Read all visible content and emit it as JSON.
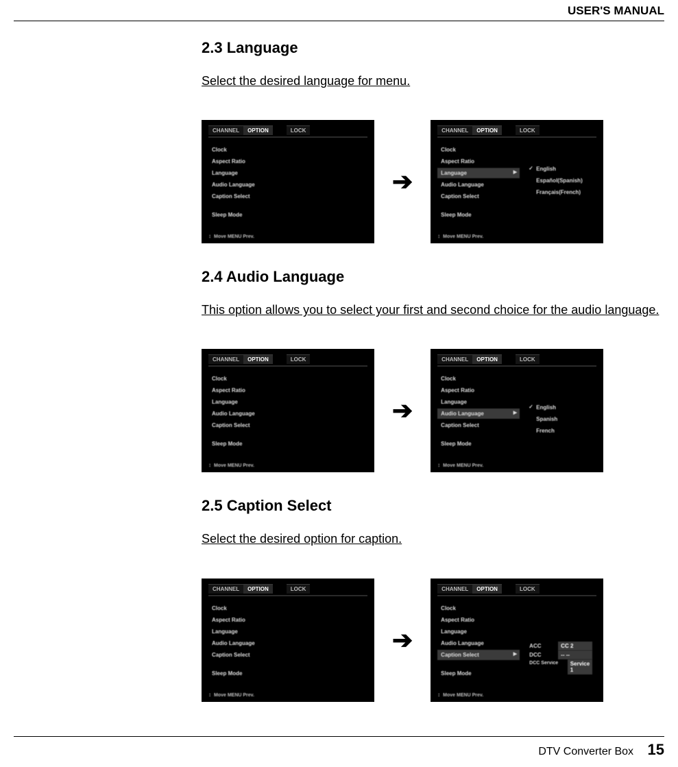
{
  "header": {
    "title": "USER'S MANUAL"
  },
  "footer": {
    "product": "DTV Converter Box",
    "page": "15"
  },
  "sections": [
    {
      "num": "2.3 Language",
      "desc": "Select the desired language for menu."
    },
    {
      "num": "2.4 Audio Language",
      "desc": "This option allows you to select your first and second choice for the audio language."
    },
    {
      "num": "2.5 Caption Select",
      "desc": "Select the desired option for caption."
    }
  ],
  "tv_common": {
    "tabs": {
      "channel": "CHANNEL",
      "option": "OPTION",
      "lock": "LOCK"
    },
    "menu_items": {
      "clock": "Clock",
      "aspect": "Aspect Ratio",
      "language": "Language",
      "audio": "Audio Language",
      "caption": "Caption Select",
      "sleep": "Sleep Mode"
    },
    "footer_hint": "Move  MENU Prev."
  },
  "lang_options": {
    "english": "English",
    "spanish": "Español(Spanish)",
    "french": "Français(French)"
  },
  "audio_options": {
    "english": "English",
    "spanish": "Spanish",
    "french": "French"
  },
  "caption_options": {
    "acc_label": "ACC",
    "acc_value": "CC 2",
    "dcc_label": "DCC",
    "dcc_value": "-- --",
    "dccsvc_label": "DCC Service",
    "dccsvc_value": "Service 1"
  }
}
